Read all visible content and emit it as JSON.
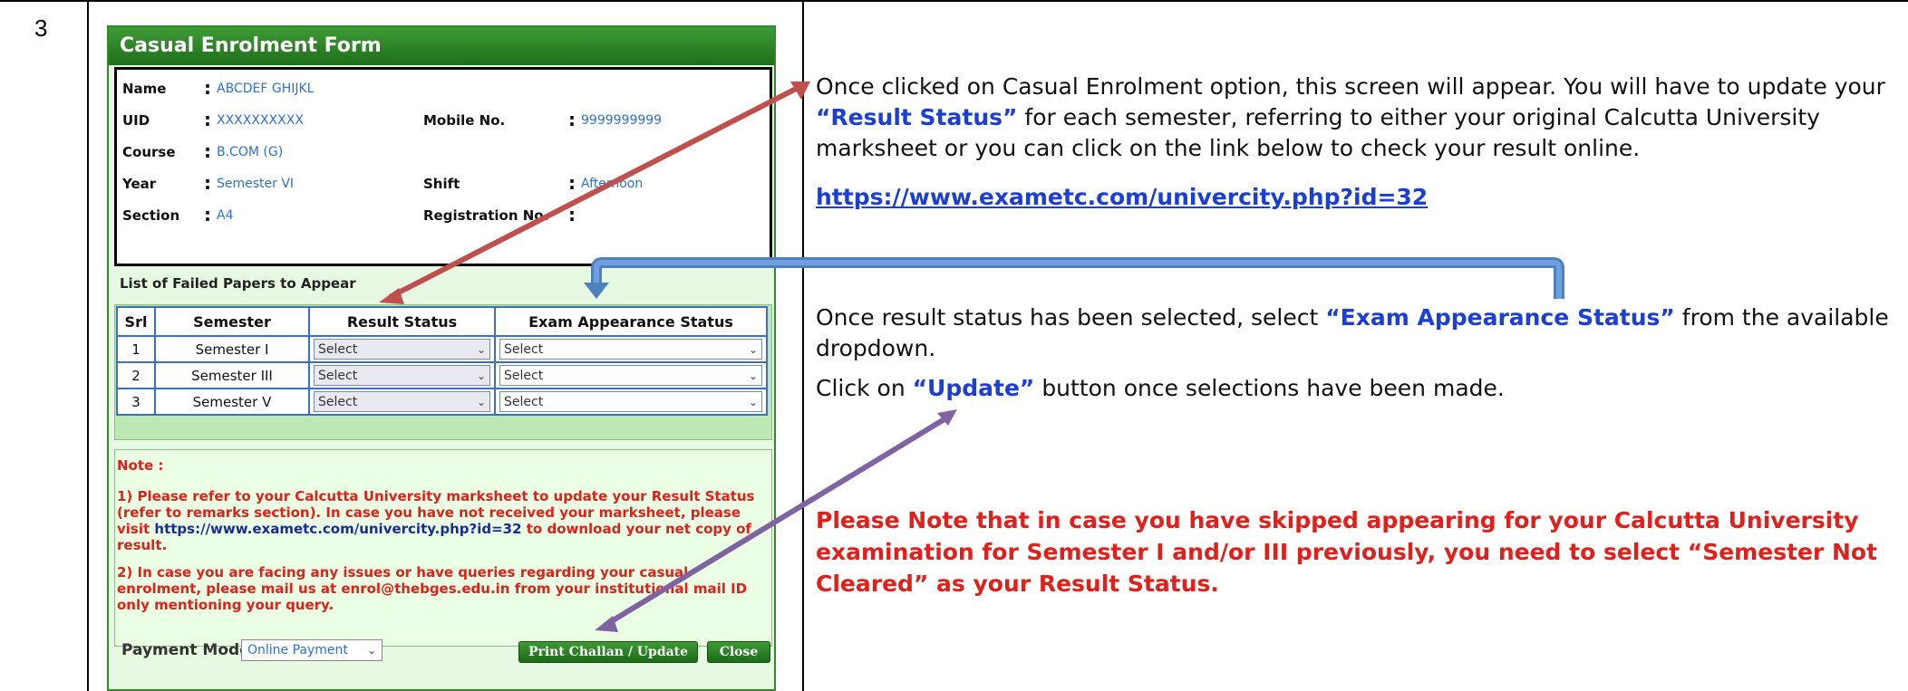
{
  "row_number": "3",
  "form": {
    "title": "Casual Enrolment Form",
    "fields": {
      "name_label": "Name",
      "name_value": "ABCDEF GHIJKL",
      "uid_label": "UID",
      "uid_value": "XXXXXXXXXX",
      "mobile_label": "Mobile No.",
      "mobile_value": "9999999999",
      "course_label": "Course",
      "course_value": "B.COM (G)",
      "year_label": "Year",
      "year_value": "Semester VI",
      "shift_label": "Shift",
      "shift_value": "Afternoon",
      "section_label": "Section",
      "section_value": "A4",
      "registration_label": "Registration No.",
      "registration_value": ""
    },
    "colon": ":",
    "papers_title": "List of Failed Papers to Appear",
    "table": {
      "headers": [
        "Srl",
        "Semester",
        "Result Status",
        "Exam Appearance Status"
      ],
      "rows": [
        {
          "srl": "1",
          "semester": "Semester I",
          "result": "Select",
          "appearance": "Select"
        },
        {
          "srl": "2",
          "semester": "Semester III",
          "result": "Select",
          "appearance": "Select"
        },
        {
          "srl": "3",
          "semester": "Semester V",
          "result": "Select",
          "appearance": "Select"
        }
      ]
    },
    "note": {
      "heading": "Note :",
      "item1_a": "1) Please refer to your Calcutta University marksheet to update your Result Status (refer to remarks section). In case you have not received your marksheet, please visit",
      "item1_link": "https://www.exametc.com/univercity.php?id=32",
      "item1_b": "to download your net copy of result.",
      "item2": "2) In case you are facing any issues or have queries regarding your casual enrolment, please mail us at enrol@thebges.edu.in from your institutional mail ID only mentioning your query."
    },
    "payment_label": "Payment Mode",
    "payment_value": "Online Payment",
    "print_button": "Print Challan / Update",
    "close_button": "Close"
  },
  "instructions": {
    "p1_a": "Once clicked on Casual Enrolment option, this screen will appear. You will have to update your",
    "p1_em": "“Result Status”",
    "p1_b": "for each semester, referring to either your original Calcutta University marksheet or you can click on the link below to check your result online.",
    "link": "https://www.exametc.com/univercity.php?id=32",
    "p2_a": "Once result status has been selected, select",
    "p2_em": "“Exam Appearance Status”",
    "p2_b": "from the available dropdown.",
    "p3_a": "Click on",
    "p3_em": "“Update”",
    "p3_b": "button once selections have been made.",
    "warning": "Please Note that in case you have skipped appearing for your Calcutta University examination for Semester I and/or III previously, you need to select “Semester Not Cleared” as your Result Status."
  },
  "colors": {
    "form_green": "#2f8a2a",
    "link_blue": "#1b3fd6",
    "warning_red": "#e0201a",
    "arrow_red": "#c0504d",
    "arrow_blue": "#4f81bd",
    "arrow_purple": "#8064a2"
  }
}
